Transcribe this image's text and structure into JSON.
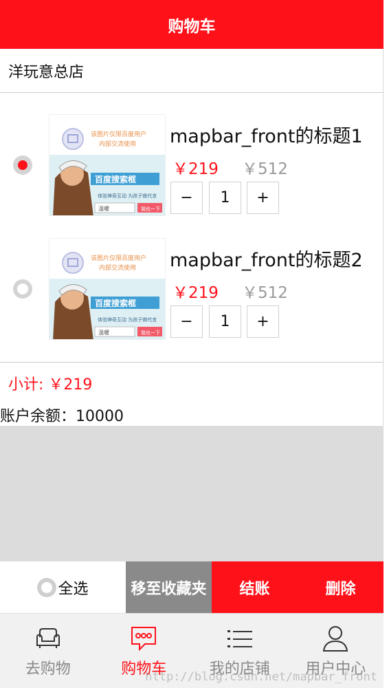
{
  "header": {
    "title": "购物车"
  },
  "store": {
    "name": "洋玩意总店"
  },
  "items": [
    {
      "checked": true,
      "title": "mapbar_front的标题1",
      "price": "￥219",
      "old_price": "￥512",
      "quantity": "1",
      "minus": "−",
      "plus": "+",
      "image": {
        "notice_line1": "该图片仅限百度用户",
        "notice_line2": "内部交流使用",
        "brand": "百度搜索框",
        "slogan": "体验神奇互动 为孩子做代言",
        "search_text": "温暖",
        "button": "我也一下"
      }
    },
    {
      "checked": false,
      "title": "mapbar_front的标题2",
      "price": "￥219",
      "old_price": "￥512",
      "quantity": "1",
      "minus": "−",
      "plus": "+",
      "image": {
        "notice_line1": "该图片仅限百度用户",
        "notice_line2": "内部交流使用",
        "brand": "百度搜索框",
        "slogan": "体验神奇互动 为孩子做代言",
        "search_text": "温暖",
        "button": "我也一下"
      }
    }
  ],
  "summary": {
    "subtotal": "小计: ￥219",
    "balance": "账户余额：10000"
  },
  "actions": {
    "select_all": "全选",
    "move_to_favorites": "移至收藏夹",
    "checkout": "结账",
    "delete": "删除"
  },
  "tabs": [
    {
      "label": "去购物",
      "icon": "sofa-icon",
      "active": false
    },
    {
      "label": "购物车",
      "icon": "chat-bubble-icon",
      "active": true
    },
    {
      "label": "我的店铺",
      "icon": "list-icon",
      "active": false
    },
    {
      "label": "用户中心",
      "icon": "user-icon",
      "active": false
    }
  ],
  "watermark": "http://blog.csdn.net/mapbar_front",
  "colors": {
    "accent": "#ff111a",
    "gray_button": "#8a8a8a",
    "tab_inactive": "#888888"
  }
}
